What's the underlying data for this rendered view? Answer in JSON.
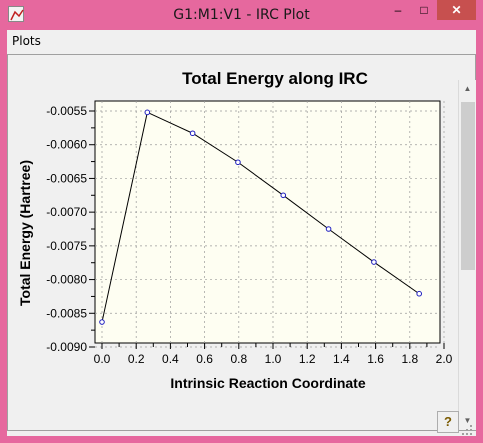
{
  "window": {
    "title": "G1:M1:V1 - IRC Plot",
    "controls": {
      "minimize": "–",
      "maximize": "□",
      "close": "✕"
    }
  },
  "menu": {
    "items": [
      {
        "label": "Plots"
      }
    ]
  },
  "help_button": {
    "label": "?"
  },
  "chart_data": {
    "type": "line",
    "title": "Total Energy along IRC",
    "xlabel": "Intrinsic Reaction Coordinate",
    "ylabel": "Total Energy (Hartree)",
    "xlim": [
      0.0,
      2.0
    ],
    "ylim": [
      -0.009,
      -0.0053
    ],
    "xticks": [
      "0.0",
      "0.2",
      "0.4",
      "0.6",
      "0.8",
      "1.0",
      "1.2",
      "1.4",
      "1.6",
      "1.8",
      "2.0"
    ],
    "yticks": [
      "-0.0055",
      "-0.0060",
      "-0.0065",
      "-0.0070",
      "-0.0075",
      "-0.0080",
      "-0.0085",
      "-0.0090"
    ],
    "grid": true,
    "x": [
      0.0,
      0.265,
      0.53,
      0.795,
      1.06,
      1.325,
      1.59,
      1.855
    ],
    "y": [
      -0.00863,
      -0.00552,
      -0.00583,
      -0.00626,
      -0.00675,
      -0.00725,
      -0.00774,
      -0.00821
    ],
    "colors": {
      "line": "#000000",
      "marker": "#2020c0",
      "plot_bg": "#fefef2",
      "grid": "#9a9a9a"
    }
  }
}
